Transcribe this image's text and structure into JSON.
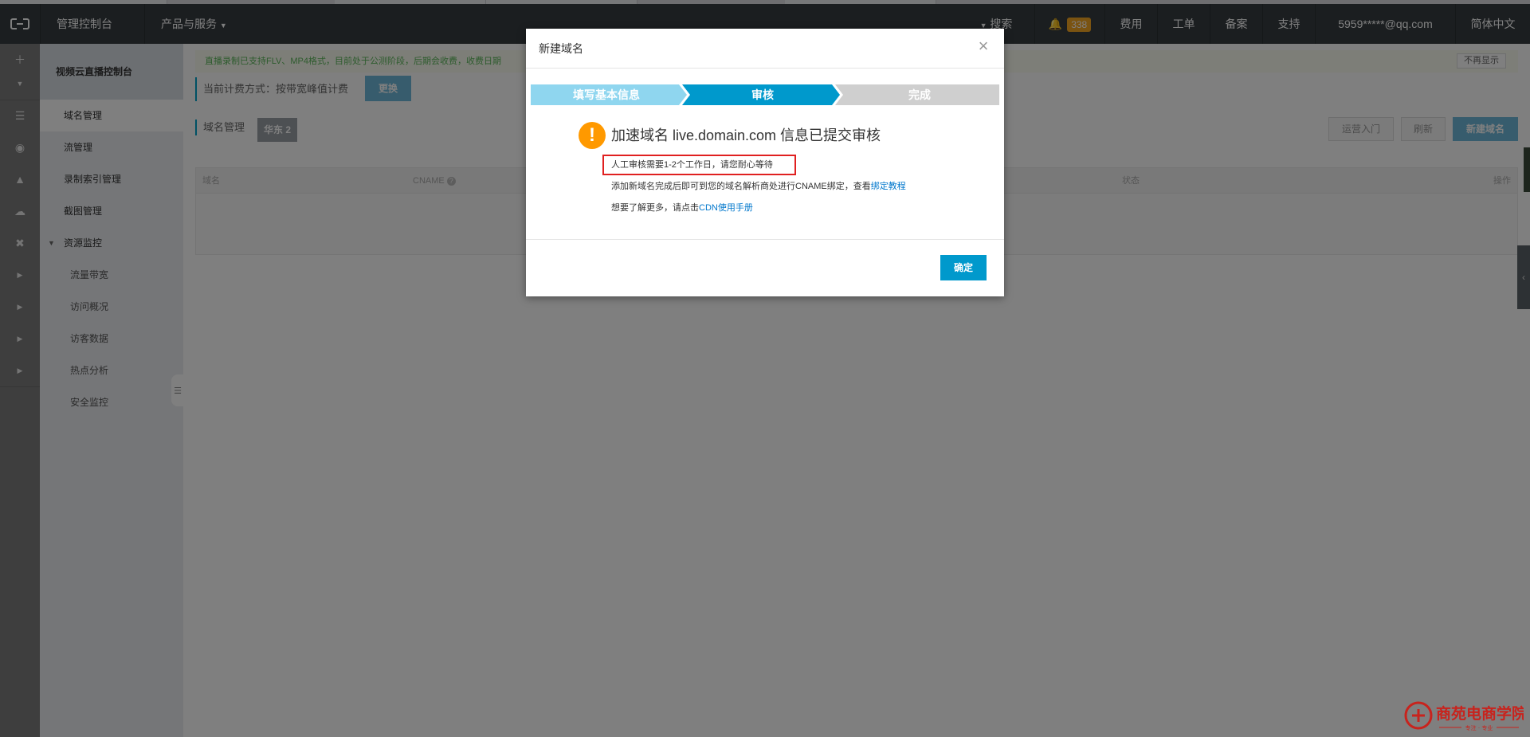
{
  "topbar": {
    "console": "管理控制台",
    "products": "产品与服务",
    "search": "搜索",
    "notifications": "338",
    "billing": "费用",
    "tickets": "工单",
    "icp": "备案",
    "support": "支持",
    "account": "5959*****@qq.com",
    "language": "简体中文"
  },
  "sidebar": {
    "title": "视频云直播控制台",
    "items": [
      "域名管理",
      "流管理",
      "录制索引管理",
      "截图管理",
      "资源监控"
    ],
    "sub_items": [
      "流量带宽",
      "访问概况",
      "访客数据",
      "热点分析",
      "安全监控"
    ]
  },
  "main": {
    "notice": "直播录制已支持FLV、MP4格式，目前处于公测阶段，后期会收费，收费日期",
    "notice_close": "不再显示",
    "billing_label": "当前计费方式：按带宽峰值计费",
    "change_button": "更换",
    "domain_title": "域名管理",
    "region": "华东 2",
    "quickstart": "运营入门",
    "refresh": "刷新",
    "new_domain": "新建域名",
    "columns": {
      "domain": "域名",
      "cname": "CNAME",
      "status": "状态",
      "actions": "操作"
    }
  },
  "modal": {
    "title": "新建域名",
    "steps": [
      "填写基本信息",
      "审核",
      "完成"
    ],
    "heading": "加速域名 live.domain.com 信息已提交审核",
    "review_note": "人工审核需要1-2个工作日，请您耐心等待",
    "cname_prefix": "添加新域名完成后即可到您的域名解析商处进行CNAME绑定，查看",
    "cname_link": "绑定教程",
    "more_prefix": "想要了解更多，请点击",
    "more_link": "CDN使用手册",
    "ok": "确定"
  },
  "watermark": {
    "brand": "商苑电商学院",
    "slogan": "专注 · 专业"
  },
  "colors": {
    "accent": "#00a2ca",
    "step_active": "#0099cc",
    "step_done": "#8fd6ef",
    "warning": "#ff9900",
    "highlight": "#e02020"
  }
}
